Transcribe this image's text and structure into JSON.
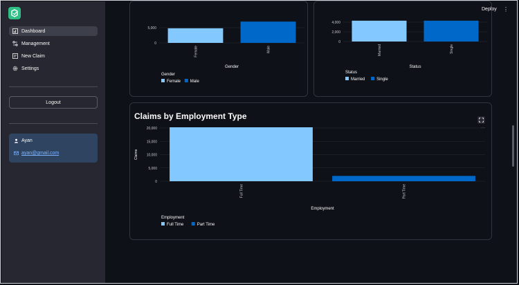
{
  "sidebar": {
    "nav": [
      {
        "label": "Dashboard",
        "icon": "dashboard-icon",
        "active": true
      },
      {
        "label": "Management",
        "icon": "management-icon",
        "active": false
      },
      {
        "label": "New Claim",
        "icon": "new-claim-icon",
        "active": false
      },
      {
        "label": "Settings",
        "icon": "settings-icon",
        "active": false
      }
    ],
    "logout_label": "Logout",
    "user": {
      "name": "Ayan",
      "email": "ayan@gmail.com"
    }
  },
  "header": {
    "deploy_label": "Deploy",
    "menu_glyph": "⋮"
  },
  "colors": {
    "full_bar": "#83c9ff",
    "part_bar": "#0068c9",
    "sidebar": "#262730",
    "background": "#0e1117",
    "user_card": "#2e4461"
  },
  "chart_data": [
    {
      "type": "bar",
      "categories": [
        "Female",
        "Male"
      ],
      "values": [
        4800,
        7000
      ],
      "xlabel": "Gender",
      "yticks": [
        "5,000",
        "0"
      ],
      "legend_title": "Gender",
      "legend": [
        "Female",
        "Male"
      ]
    },
    {
      "type": "bar",
      "categories": [
        "Married",
        "Single"
      ],
      "values": [
        4300,
        4300
      ],
      "xlabel": "Status",
      "yticks": [
        "4,000",
        "2,000",
        "0"
      ],
      "legend_title": "Status",
      "legend": [
        "Married",
        "Single"
      ]
    },
    {
      "type": "bar",
      "title": "Claims by Employment Type",
      "categories": [
        "Full Time",
        "Part Time"
      ],
      "values": [
        20300,
        2000
      ],
      "xlabel": "Employment",
      "ylabel": "Claims",
      "yticks": [
        "20,000",
        "15,000",
        "10,000",
        "5,000",
        "0"
      ],
      "ylim": [
        0,
        20000
      ],
      "legend_title": "Employment",
      "legend": [
        "Full Time",
        "Part Time"
      ]
    }
  ]
}
